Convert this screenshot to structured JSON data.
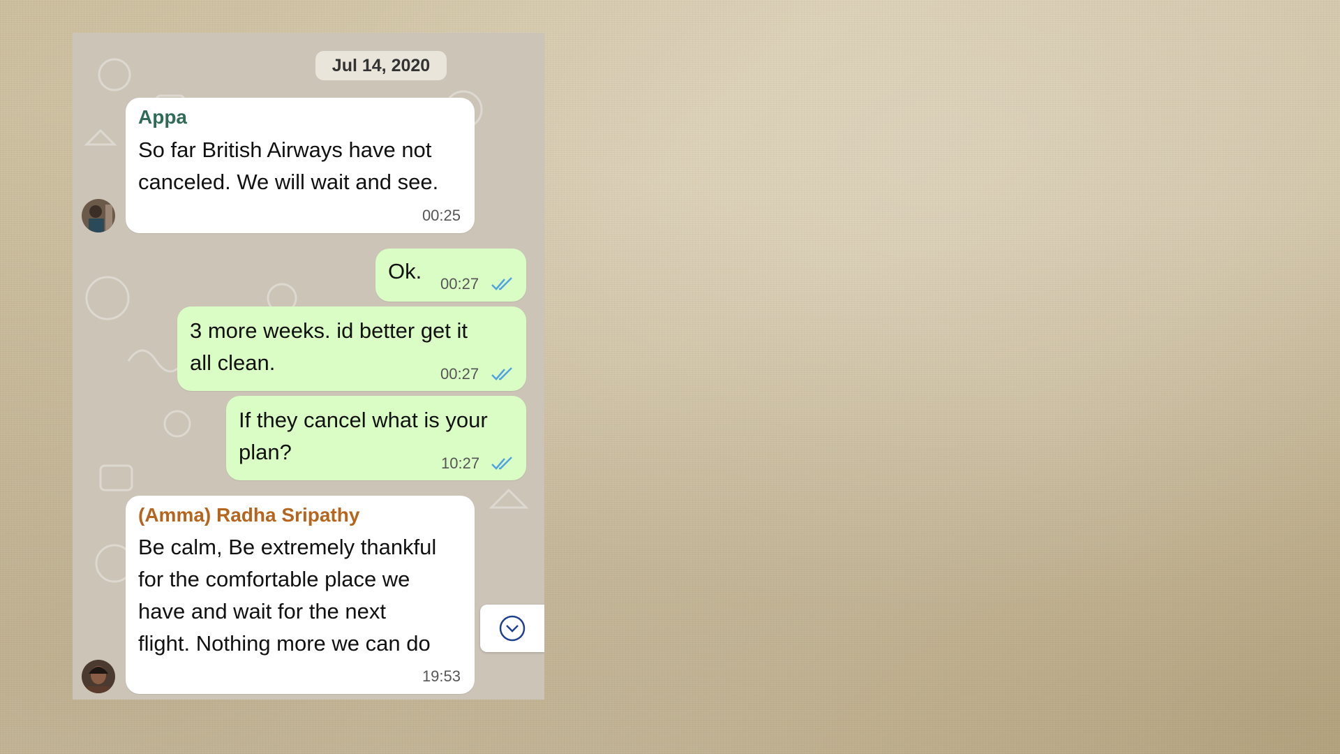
{
  "chat": {
    "date_label": "Jul 14, 2020",
    "messages": [
      {
        "direction": "incoming",
        "sender": "Appa",
        "sender_color": "#2f6b56",
        "lines": [
          "So far British Airways have not",
          "canceled. We will wait and see."
        ],
        "time": "00:25"
      },
      {
        "direction": "outgoing",
        "lines": [
          "Ok."
        ],
        "time": "00:27",
        "status": "read"
      },
      {
        "direction": "outgoing",
        "lines": [
          "3 more weeks. id better get it",
          "all clean."
        ],
        "time": "00:27",
        "status": "read"
      },
      {
        "direction": "outgoing",
        "lines": [
          "If they cancel what is your",
          "plan?"
        ],
        "time": "10:27",
        "status": "read"
      },
      {
        "direction": "incoming",
        "sender": "(Amma) Radha Sripathy",
        "sender_color": "#b5651d",
        "lines": [
          "Be calm, Be extremely thankful",
          "for the comfortable place we",
          "have and wait for the next",
          "flight. Nothing more we can do"
        ],
        "time": "19:53"
      }
    ],
    "colors": {
      "outgoing_bubble": "#d9fdc4",
      "incoming_bubble": "#ffffff",
      "read_ticks": "#4fa3e0"
    },
    "icons": {
      "read_status": "double-check-icon",
      "scroll": "chevron-down-circle-icon"
    }
  }
}
